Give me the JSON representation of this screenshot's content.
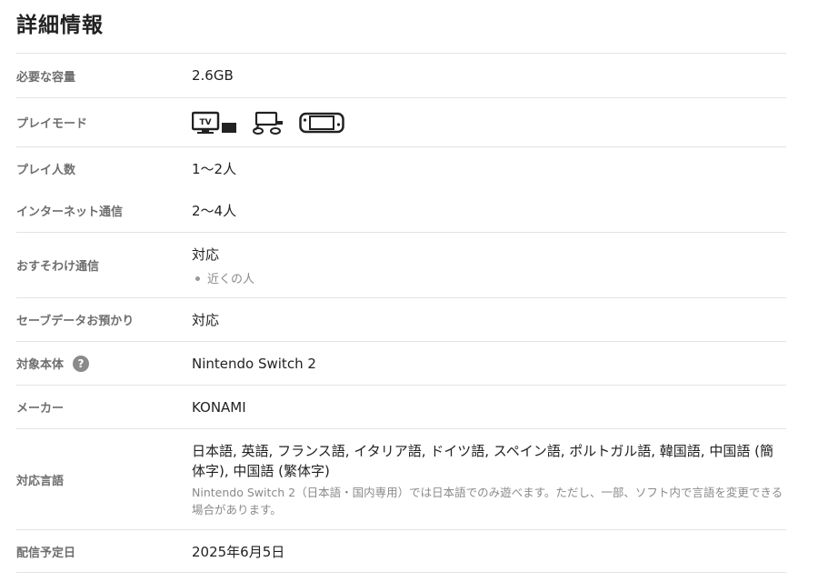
{
  "page_title": "詳細情報",
  "rows": {
    "capacity": {
      "label": "必要な容量",
      "value": "2.6GB"
    },
    "play_mode": {
      "label": "プレイモード",
      "icons": [
        "tv-mode-icon",
        "tabletop-mode-icon",
        "handheld-mode-icon"
      ]
    },
    "players": {
      "label": "プレイ人数",
      "value": "1〜2人"
    },
    "online": {
      "label": "インターネット通信",
      "value": "2〜4人"
    },
    "share": {
      "label": "おすそわけ通信",
      "value": "対応",
      "sub": "近くの人"
    },
    "save_backup": {
      "label": "セーブデータお預かり",
      "value": "対応"
    },
    "platform": {
      "label": "対象本体",
      "help": "?",
      "value": "Nintendo Switch 2"
    },
    "maker": {
      "label": "メーカー",
      "value": "KONAMI"
    },
    "languages": {
      "label": "対応言語",
      "value": "日本語, 英語, フランス語, イタリア語, ドイツ語, スペイン語, ポルトガル語, 韓国語, 中国語 (簡体字), 中国語 (繁体字)",
      "note": "Nintendo Switch 2（日本語・国内専用）では日本語でのみ遊べます。ただし、一部、ソフト内で言語を変更できる場合があります。"
    },
    "release": {
      "label": "配信予定日",
      "value": "2025年6月5日"
    }
  }
}
